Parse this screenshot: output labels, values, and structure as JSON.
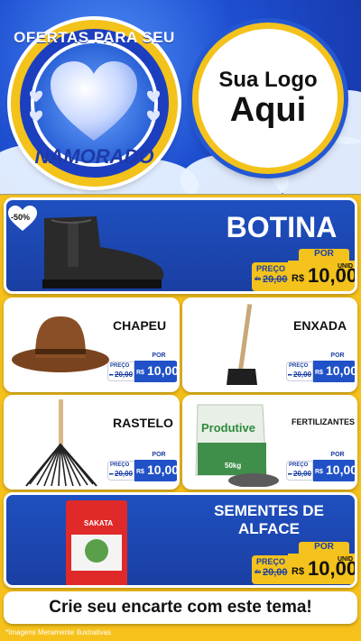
{
  "header": {
    "badge_top": "OFERTAS PARA SEU",
    "badge_bottom": "NAMORADO",
    "logo_line1": "Sua Logo",
    "logo_line2": "Aqui"
  },
  "colors": {
    "blue": "#1f4fbf",
    "yellow": "#f4c21c",
    "white": "#ffffff"
  },
  "products": [
    {
      "name": "BOTINA",
      "discount": "-50%",
      "por": "POR",
      "preco": "PREÇO",
      "de": "de",
      "old": "20,00",
      "currency": "R$",
      "price": "10,00",
      "unit": "UNID",
      "icon": "boot-icon"
    },
    {
      "name": "CHAPEU",
      "por": "POR",
      "preco": "PREÇO",
      "de": "de",
      "old": "20,00",
      "currency": "R$",
      "price": "10,00",
      "icon": "hat-icon"
    },
    {
      "name": "ENXADA",
      "por": "POR",
      "preco": "PREÇO",
      "de": "de",
      "old": "20,00",
      "currency": "R$",
      "price": "10,00",
      "icon": "hoe-icon"
    },
    {
      "name": "RASTELO",
      "por": "POR",
      "preco": "PREÇO",
      "de": "de",
      "old": "20,00",
      "currency": "R$",
      "price": "10,00",
      "icon": "rake-icon"
    },
    {
      "name": "FERTILIZANTES",
      "por": "POR",
      "preco": "PREÇO",
      "de": "de",
      "old": "20,00",
      "currency": "R$",
      "price": "10,00",
      "icon": "fertilizer-bag-icon",
      "bag_brand": "Produtive",
      "bag_weight": "50kg"
    },
    {
      "name_line1": "SEMENTES DE",
      "name_line2": "ALFACE",
      "por": "POR",
      "preco": "PREÇO",
      "de": "de",
      "old": "20,00",
      "currency": "R$",
      "price": "10,00",
      "unit": "UNID",
      "icon": "seed-pack-icon",
      "pack_brand": "SAKATA"
    }
  ],
  "cta": "Crie seu encarte com este tema!",
  "disclaimer": "*Imagens Meramente Ilustrativas"
}
